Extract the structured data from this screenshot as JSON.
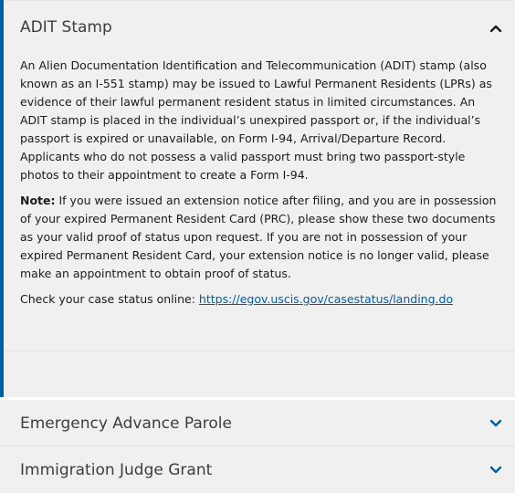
{
  "accordion": {
    "open_item": {
      "title": "ADIT Stamp",
      "paragraph1": "An Alien Documentation Identification and Telecommunication (ADIT) stamp (also known as an I-551 stamp) may be issued to Lawful Permanent Residents (LPRs) as evidence of their lawful permanent resident status in limited circumstances. An ADIT stamp is placed in the individual’s unexpired passport or, if the individual’s passport is expired or unavailable, on Form I-94, Arrival/Departure Record. Applicants who do not possess a valid passport must bring two passport-style photos to their appointment to create a Form I-94.",
      "note_label": "Note:",
      "note_text": " If you were issued an extension notice after filing, and you are in possession of your expired Permanent Resident Card (PRC), please show these two documents as your valid proof of status upon request. If you are not in possession of your expired Permanent Resident Card, your extension notice is no longer valid, please make an appointment to obtain proof of status.",
      "case_status_prefix": "Check your case status online: ",
      "case_status_link": "https://egov.uscis.gov/casestatus/landing.do",
      "chevron_icon": "chevron-up-icon"
    },
    "closed_items": [
      {
        "title": "Emergency Advance Parole",
        "chevron_icon": "chevron-down-icon"
      },
      {
        "title": "Immigration Judge Grant",
        "chevron_icon": "chevron-down-icon"
      }
    ]
  },
  "colors": {
    "accent": "#005ea2",
    "panel_background": "#f0f0f0",
    "text": "#1b1b1b",
    "title_text": "#3d3d3d"
  }
}
